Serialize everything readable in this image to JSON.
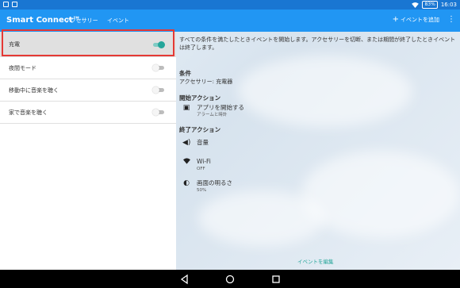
{
  "status_bar": {
    "battery": "83%",
    "time": "16:03"
  },
  "app_bar": {
    "title": "Smart Connect™",
    "tabs": [
      {
        "label": "アクセサリー"
      },
      {
        "label": "イベント"
      }
    ],
    "add_event_label": "イベントを追加",
    "overflow_glyph": "⋮"
  },
  "events": [
    {
      "label": "充電",
      "enabled": true,
      "selected": true
    },
    {
      "label": "夜間モード",
      "enabled": false,
      "selected": false
    },
    {
      "label": "移動中に音楽を聴く",
      "enabled": false,
      "selected": false
    },
    {
      "label": "家で音楽を聴く",
      "enabled": false,
      "selected": false
    }
  ],
  "detail": {
    "description": "すべての条件を満たしたときイベントを開始します。アクセサリーを切断、または期間が終了したときイベントは終了します。",
    "condition_heading": "条件",
    "condition_value": "アクセサリー: 充電器",
    "start_heading": "開始アクション",
    "start_actions": [
      {
        "icon": "app-launch-icon",
        "title": "アプリを開始する",
        "sub": "アラームと時計"
      }
    ],
    "end_heading": "終了アクション",
    "end_actions": [
      {
        "icon": "volume-icon",
        "title": "音量",
        "sub": ""
      },
      {
        "icon": "wifi-icon",
        "title": "Wi-Fi",
        "sub": "OFF"
      },
      {
        "icon": "brightness-icon",
        "title": "画面の明るさ",
        "sub": "50%"
      }
    ],
    "edit_label": "イベントを編集"
  },
  "colors": {
    "status_bar": "#1976d2",
    "app_bar": "#2196f3",
    "accent": "#26a69a",
    "highlight": "#e53935"
  }
}
